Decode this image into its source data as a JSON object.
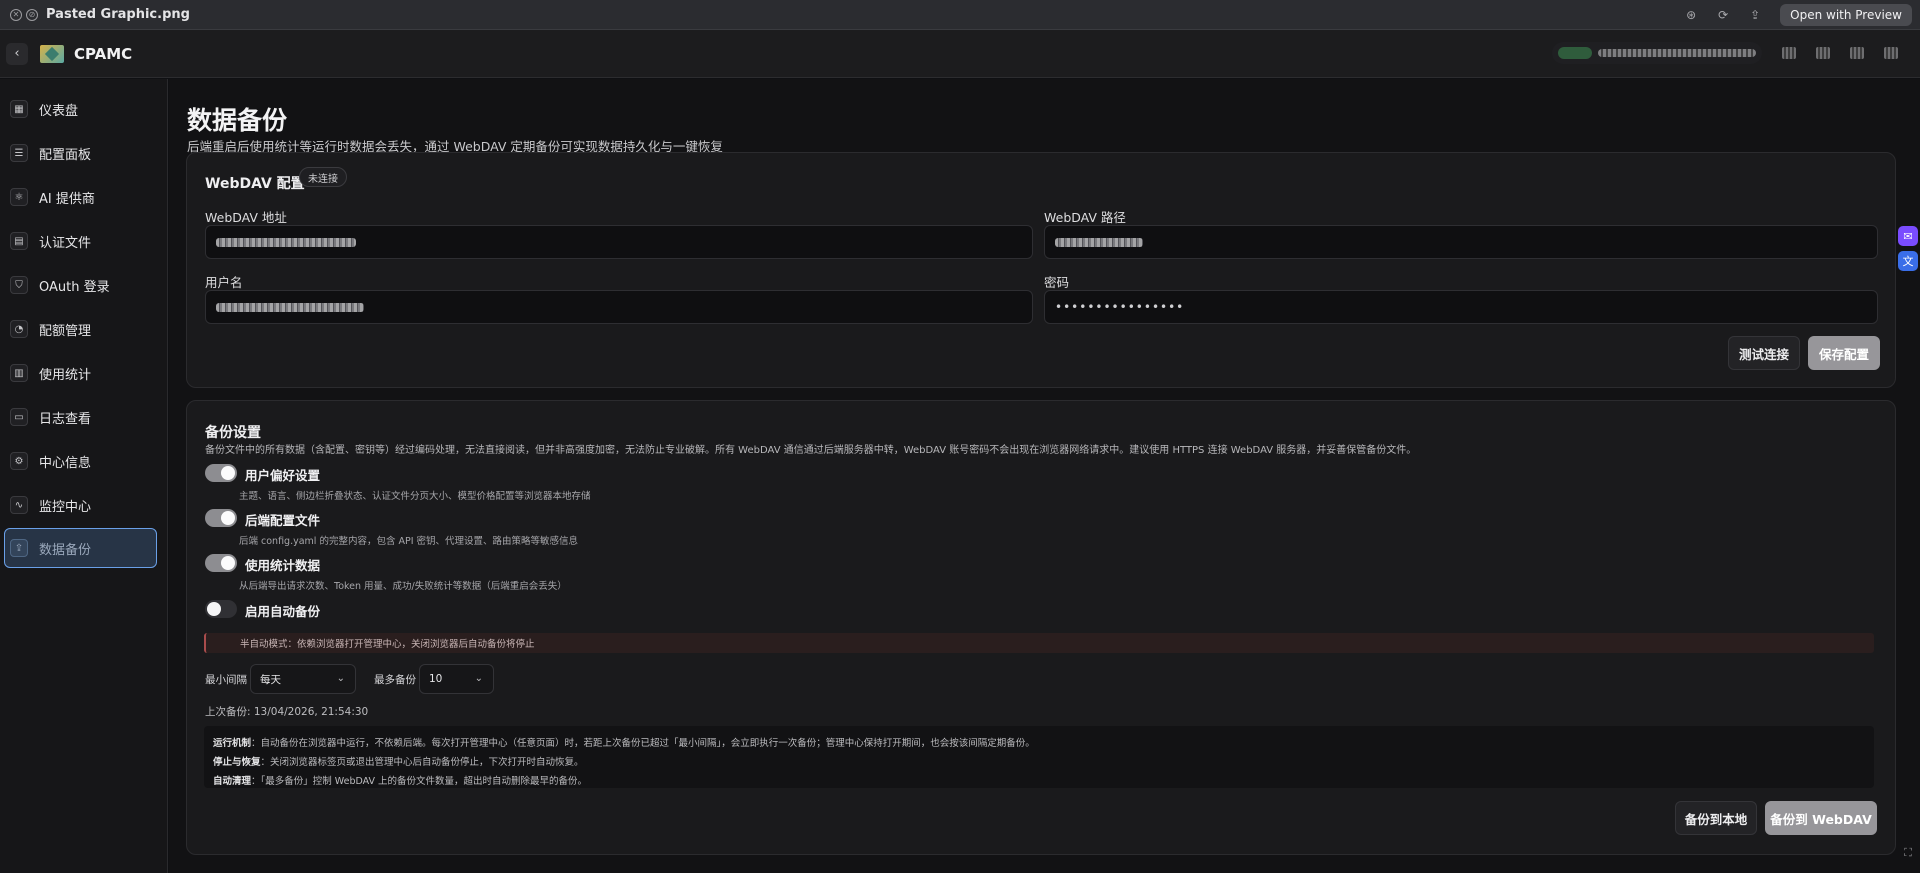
{
  "window": {
    "title": "Pasted Graphic.png",
    "open_with": "Open with Preview"
  },
  "header": {
    "app_name": "CPAMC"
  },
  "sidebar": {
    "items": [
      {
        "label": "仪表盘",
        "icon": "dashboard-icon",
        "glyph": "▦"
      },
      {
        "label": "配置面板",
        "icon": "sliders-icon",
        "glyph": "☰"
      },
      {
        "label": "AI 提供商",
        "icon": "network-icon",
        "glyph": "⚛"
      },
      {
        "label": "认证文件",
        "icon": "file-icon",
        "glyph": "▤"
      },
      {
        "label": "OAuth 登录",
        "icon": "shield-icon",
        "glyph": "⛉"
      },
      {
        "label": "配额管理",
        "icon": "pie-chart-icon",
        "glyph": "◔"
      },
      {
        "label": "使用统计",
        "icon": "bar-chart-icon",
        "glyph": "▥"
      },
      {
        "label": "日志查看",
        "icon": "terminal-icon",
        "glyph": "▭"
      },
      {
        "label": "中心信息",
        "icon": "gear-icon",
        "glyph": "⚙"
      },
      {
        "label": "监控中心",
        "icon": "activity-icon",
        "glyph": "∿"
      },
      {
        "label": "数据备份",
        "icon": "backup-icon",
        "glyph": "⇪"
      }
    ]
  },
  "page": {
    "title": "数据备份",
    "subtitle": "后端重启后使用统计等运行时数据会丢失，通过 WebDAV 定期备份可实现数据持久化与一键恢复"
  },
  "webdav": {
    "title": "WebDAV 配置",
    "status": "未连接",
    "address_label": "WebDAV 地址",
    "path_label": "WebDAV 路径",
    "username_label": "用户名",
    "password_label": "密码",
    "password_value": "••••••••••••••••",
    "test_button": "测试连接",
    "save_button": "保存配置"
  },
  "backup": {
    "title": "备份设置",
    "description": "备份文件中的所有数据（含配置、密钥等）经过编码处理，无法直接阅读，但并非高强度加密，无法防止专业破解。所有 WebDAV 通信通过后端服务器中转，WebDAV 账号密码不会出现在浏览器网络请求中。建议使用 HTTPS 连接 WebDAV 服务器，并妥善保管备份文件。",
    "toggles": [
      {
        "title": "用户偏好设置",
        "desc": "主题、语言、侧边栏折叠状态、认证文件分页大小、模型价格配置等浏览器本地存储",
        "on": true
      },
      {
        "title": "后端配置文件",
        "desc": "后端 config.yaml 的完整内容，包含 API 密钥、代理设置、路由策略等敏感信息",
        "on": true
      },
      {
        "title": "使用统计数据",
        "desc": "从后端导出请求次数、Token 用量、成功/失败统计等数据（后端重启会丢失）",
        "on": true
      },
      {
        "title": "启用自动备份",
        "desc": "",
        "on": false
      }
    ],
    "warning": "半自动模式：依赖浏览器打开管理中心，关闭浏览器后自动备份将停止",
    "interval_label": "最小间隔",
    "interval_value": "每天",
    "max_label": "最多备份",
    "max_value": "10",
    "last_backup": "上次备份: 13/04/2026, 21:54:30",
    "info": [
      {
        "key": "运行机制",
        "text": "：自动备份在浏览器中运行，不依赖后端。每次打开管理中心（任意页面）时，若距上次备份已超过「最小间隔」，会立即执行一次备份；管理中心保持打开期间，也会按该间隔定期备份。"
      },
      {
        "key": "停止与恢复",
        "text": "：关闭浏览器标签页或退出管理中心后自动备份停止，下次打开时自动恢复。"
      },
      {
        "key": "自动清理",
        "text": "：「最多备份」控制 WebDAV 上的备份文件数量，超出时自动删除最早的备份。"
      }
    ],
    "local_button": "备份到本地",
    "webdav_button": "备份到 WebDAV"
  }
}
